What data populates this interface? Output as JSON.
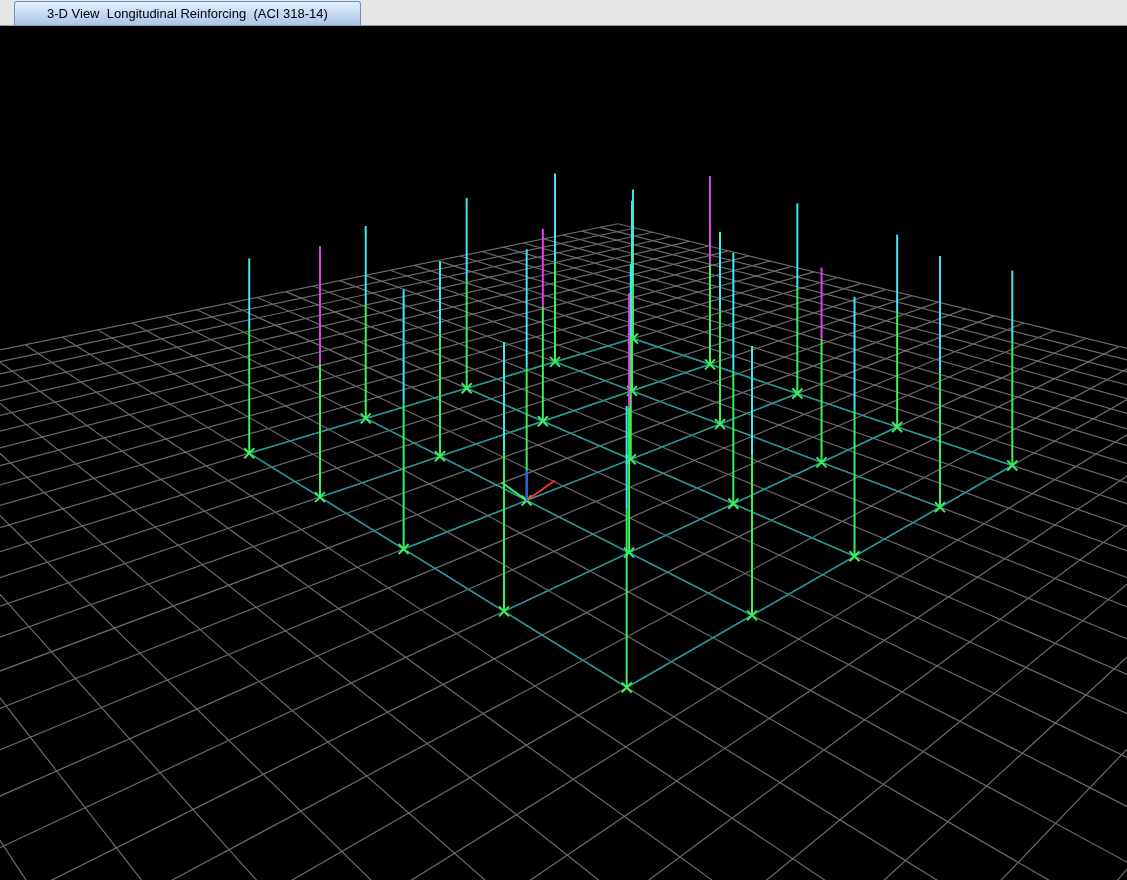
{
  "tab": {
    "title": "3-D View  Longitudinal Reinforcing  (ACI 318-14)",
    "selected": true
  }
}
